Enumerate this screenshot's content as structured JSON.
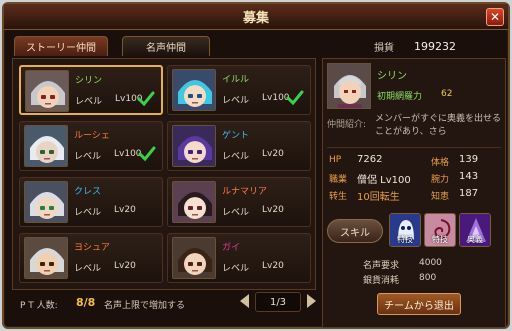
{
  "window": {
    "title": "募集",
    "close_label": "✕"
  },
  "tabs": [
    {
      "label": "ストーリー仲間",
      "active": false
    },
    {
      "label": "名声仲間",
      "active": true
    }
  ],
  "funds": {
    "label": "損貨",
    "value": "199232"
  },
  "level_label": "レベル",
  "members": [
    {
      "name": "シリン",
      "name_color": "#8fe06a",
      "level": "Lv100",
      "checked": true,
      "selected": true
    },
    {
      "name": "イルル",
      "name_color": "#8fe06a",
      "level": "Lv100",
      "checked": true,
      "selected": false
    },
    {
      "name": "ルーシェ",
      "name_color": "#ff7a40",
      "level": "Lv100",
      "checked": true,
      "selected": false
    },
    {
      "name": "ゲント",
      "name_color": "#40b8f0",
      "level": "Lv20",
      "checked": false,
      "selected": false
    },
    {
      "name": "クレス",
      "name_color": "#40b8f0",
      "level": "Lv20",
      "checked": false,
      "selected": false
    },
    {
      "name": "ルナマリア",
      "name_color": "#ff7a40",
      "level": "Lv20",
      "checked": false,
      "selected": false
    },
    {
      "name": "ヨシュア",
      "name_color": "#ff7a40",
      "level": "Lv20",
      "checked": false,
      "selected": false
    },
    {
      "name": "ガイ",
      "name_color": "#e03a9a",
      "level": "Lv20",
      "checked": false,
      "selected": false
    }
  ],
  "party": {
    "label": "P T 人数:",
    "value": "8/8",
    "note": "名声上限で増加する"
  },
  "pager": {
    "text": "1/3"
  },
  "detail": {
    "name": "シリン",
    "skill_name": "初期網羅力",
    "skill_level": "62",
    "intro_label": "仲間紹介:",
    "intro_text": "メンバーがすぐに奥義を出せることがあり、さら",
    "stats": {
      "hp_label": "HP",
      "hp_value": "7262",
      "job_label": "職業",
      "job_value": "僧侶 Lv100",
      "rebirth_label": "转生",
      "rebirth_value": "10回転生",
      "vit_label": "体格",
      "vit_value": "139",
      "str_label": "腕力",
      "str_value": "143",
      "int_label": "知恵",
      "int_value": "187"
    },
    "skill_button": "スキル",
    "skill_icons": [
      {
        "caption": "特技",
        "icon": "ghost-skill-icon"
      },
      {
        "caption": "特技",
        "icon": "swirl-skill-icon"
      },
      {
        "caption": "奥義",
        "icon": "magic-skill-icon"
      }
    ],
    "fame_req_label": "名声要求",
    "fame_req_value": "4000",
    "silver_label": "銀貨消耗",
    "silver_value": "800",
    "leave_button": "チームから退出"
  }
}
